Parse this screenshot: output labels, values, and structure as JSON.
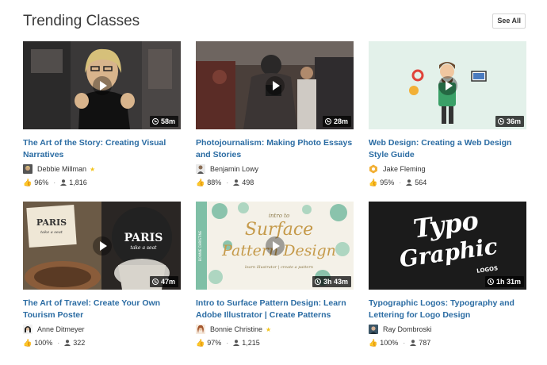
{
  "header": {
    "title": "Trending Classes",
    "see_all": "See All"
  },
  "classes": [
    {
      "title": "The Art of the Story: Creating Visual Narratives",
      "teacher": "Debbie Millman",
      "featured_teacher": true,
      "duration": "58m",
      "positive": "96%",
      "students": "1,816"
    },
    {
      "title": "Photojournalism: Making Photo Essays and Stories",
      "teacher": "Benjamin Lowy",
      "featured_teacher": false,
      "duration": "28m",
      "positive": "88%",
      "students": "498"
    },
    {
      "title": "Web Design: Creating a Web Design Style Guide",
      "teacher": "Jake Fleming",
      "featured_teacher": false,
      "duration": "36m",
      "positive": "95%",
      "students": "564"
    },
    {
      "title": "The Art of Travel: Create Your Own Tourism Poster",
      "teacher": "Anne Ditmeyer",
      "featured_teacher": false,
      "duration": "47m",
      "positive": "100%",
      "students": "322",
      "thumb_text": {
        "big": "PARIS",
        "sub": "take a seat"
      }
    },
    {
      "title": "Intro to Surface Pattern Design: Learn Adobe Illustrator | Create Patterns",
      "teacher": "Bonnie Christine",
      "featured_teacher": true,
      "duration": "3h 43m",
      "positive": "97%",
      "students": "1,215",
      "thumb_text": {
        "intro": "intro to",
        "line1": "Surface",
        "line2": "Pattern Design",
        "tag": "learn illustrator | create a pattern",
        "side": "BONNIE CHRISTINE"
      }
    },
    {
      "title": "Typographic Logos: Typography and Lettering for Logo Design",
      "teacher": "Ray Dombroski",
      "featured_teacher": false,
      "duration": "1h 31m",
      "positive": "100%",
      "students": "787",
      "thumb_text": {
        "line1": "Typo",
        "line2": "Graphic",
        "line3": "LOGOS"
      }
    }
  ],
  "colors": {
    "link": "#2b6ca3",
    "star": "#f3c41b"
  },
  "icons": {
    "duration": "clock-icon",
    "rating": "thumbs-up-icon",
    "students": "user-icon",
    "featured": "star-icon",
    "play": "play-icon"
  }
}
